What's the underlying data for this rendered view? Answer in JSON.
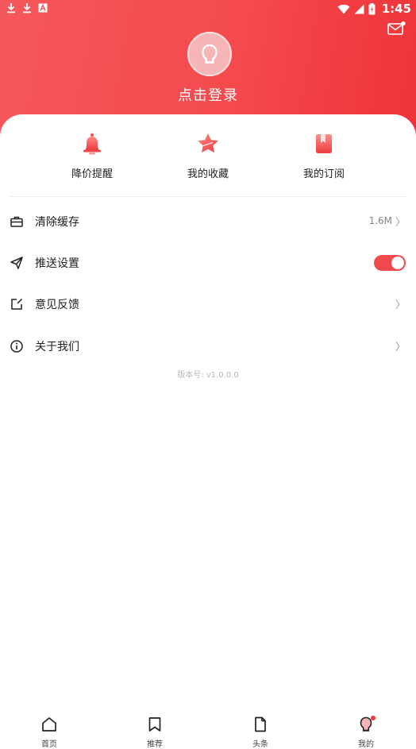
{
  "status_bar": {
    "time": "1:45",
    "left_icons": [
      "download-icon",
      "download-icon",
      "app-a-icon"
    ],
    "right_icons": [
      "wifi-icon",
      "signal-icon",
      "battery-icon"
    ]
  },
  "header": {
    "login_label": "点击登录",
    "mail_icon": "mail-icon",
    "colors": {
      "gradient_start": "#f5585c",
      "gradient_end": "#ef3338"
    }
  },
  "quick_actions": [
    {
      "label": "降价提醒",
      "icon": "bell-icon"
    },
    {
      "label": "我的收藏",
      "icon": "star-icon"
    },
    {
      "label": "我的订阅",
      "icon": "bookmark-icon"
    }
  ],
  "menu": {
    "clear_cache": {
      "label": "清除缓存",
      "value": "1.6M",
      "chevron": "〉"
    },
    "push_settings": {
      "label": "推送设置",
      "toggle_on": true
    },
    "feedback": {
      "label": "意见反馈",
      "chevron": "〉"
    },
    "about": {
      "label": "关于我们",
      "chevron": "〉"
    }
  },
  "version": "版本号: v1.0.0.0",
  "bottom_nav": [
    {
      "label": "首页",
      "icon": "home-icon"
    },
    {
      "label": "推荐",
      "icon": "bookmark-outline-icon"
    },
    {
      "label": "头条",
      "icon": "document-icon"
    },
    {
      "label": "我的",
      "icon": "profile-icon",
      "active": true
    }
  ],
  "accent_color": "#f14a4e"
}
